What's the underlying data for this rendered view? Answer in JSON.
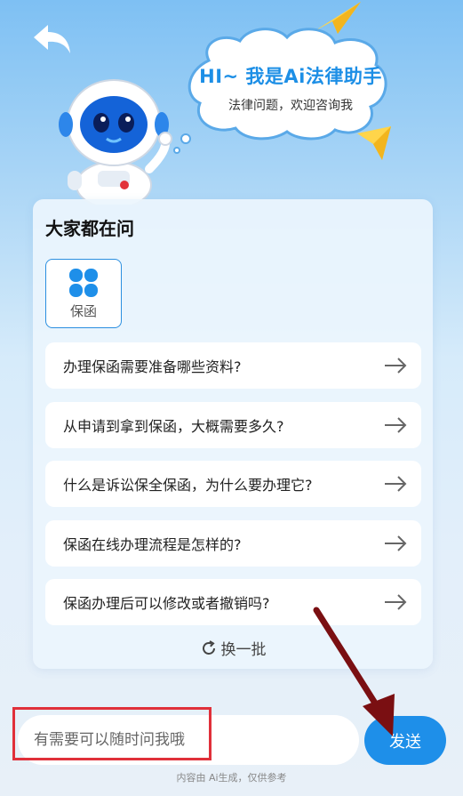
{
  "header": {
    "back_icon": "back-arrow-icon",
    "bubble_title": "HI~ 我是Ai法律助手",
    "bubble_subtitle": "法律问题，欢迎咨询我"
  },
  "card": {
    "title": "大家都在问",
    "category": {
      "label": "保函",
      "icon": "four-petal-icon"
    },
    "questions": [
      "办理保函需要准备哪些资料?",
      "从申请到拿到保函，大概需要多久?",
      "什么是诉讼保全保函，为什么要办理它?",
      "保函在线办理流程是怎样的?",
      "保函办理后可以修改或者撤销吗?"
    ],
    "refresh_label": "换一批"
  },
  "input": {
    "placeholder": "有需要可以随时问我哦",
    "value": ""
  },
  "send_label": "发送",
  "footnote": "内容由 Ai生成，仅供参考",
  "colors": {
    "accent": "#1e8fe9",
    "highlight": "#e0303a",
    "annotation_arrow": "#7a0f12"
  }
}
